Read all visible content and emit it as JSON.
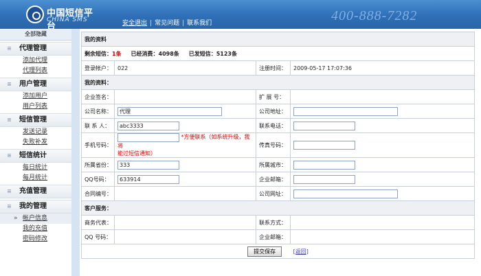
{
  "header": {
    "logo_cn": "中国短信平台",
    "logo_en": "CHINA SMS",
    "nav": [
      "安全退出",
      "常见问题",
      "联系我们"
    ],
    "phone": "400-888-7282"
  },
  "sidebar": {
    "top_label": "全部隐藏",
    "groups": [
      {
        "title": "代理管理",
        "items": [
          "添加代理",
          "代理列表"
        ]
      },
      {
        "title": "用户管理",
        "items": [
          "添加用户",
          "用户列表"
        ]
      },
      {
        "title": "短信管理",
        "items": [
          "发送记录",
          "失败补发"
        ]
      },
      {
        "title": "短信统计",
        "items": [
          "每日统计",
          "每月统计"
        ]
      },
      {
        "title": "充值管理",
        "items": []
      },
      {
        "title": "我的管理",
        "items": [
          "帐户信息",
          "我的充值",
          "密码修改"
        ]
      }
    ]
  },
  "main": {
    "title": "我的资料",
    "stats": {
      "remain_label": "剩余短信：",
      "remain_value": "1条",
      "spent_label": "已经消费：",
      "spent_value": "4098条",
      "sent_label": "已发短信：",
      "sent_value": "5123条"
    },
    "account_label": "登录帐户：",
    "account_value": "022",
    "regtime_label": "注册时间：",
    "regtime_value": "2009-05-17 17:07:36",
    "section_profile": "我的资料：",
    "sign_label": "企业签名：",
    "ext_label": "扩 展 号：",
    "company_label": "公司名称：",
    "company_value": "代理",
    "address_label": "公司地址：",
    "address_value": "",
    "contact_label": "联 系 人：",
    "contact_value": "abc3333",
    "tel_label": "联系电话：",
    "tel_value": "",
    "mobile_label": "手机号码：",
    "mobile_value": "",
    "mobile_hint_1": "*方便联系（如系统升级，我将",
    "mobile_hint_2": "能过短信通知）",
    "fax_label": "传真号码：",
    "fax_value": "",
    "province_label": "所属省份：",
    "province_value": "333",
    "city_label": "所属城市：",
    "city_value": "",
    "qq_label": "QQ号码：",
    "qq_value": "633914",
    "email_label": "企业邮箱：",
    "email_value": "",
    "contract_label": "合同编号：",
    "site_label": "公司网址：",
    "site_value": "",
    "section_service": "客户服务：",
    "rep_label": "商务代表：",
    "contact_way_label": "联系方式：",
    "qq2_label": "QQ 号码：",
    "email2_label": "企业邮箱：",
    "save_label": "提交保存",
    "back_label": "[返回]"
  }
}
